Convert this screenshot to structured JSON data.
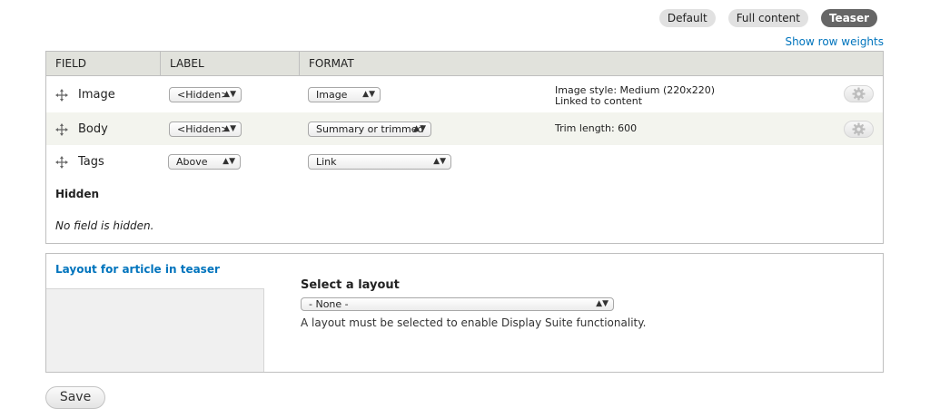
{
  "tabs": [
    {
      "label": "Default",
      "active": false
    },
    {
      "label": "Full content",
      "active": false
    },
    {
      "label": "Teaser",
      "active": true
    }
  ],
  "show_row_weights": "Show row weights",
  "table": {
    "headers": {
      "field": "FIELD",
      "label": "LABEL",
      "format": "FORMAT"
    },
    "rows": [
      {
        "name": "Image",
        "label": "<Hidden>",
        "format": "Image",
        "summary": [
          "Image style: Medium (220x220)",
          "Linked to content"
        ],
        "icons": {
          "drag": "drag-handle-icon",
          "settings": "gear-icon"
        }
      },
      {
        "name": "Body",
        "label": "<Hidden>",
        "format": "Summary or trimmed",
        "summary": [
          "Trim length: 600"
        ],
        "icons": {
          "drag": "drag-handle-icon",
          "settings": "gear-icon"
        }
      },
      {
        "name": "Tags",
        "label": "Above",
        "format": "Link",
        "summary": [],
        "icons": {
          "drag": "drag-handle-icon"
        }
      }
    ],
    "hidden_title": "Hidden",
    "hidden_empty": "No field is hidden."
  },
  "layout": {
    "title": "Layout for article in teaser",
    "select_label": "Select a layout",
    "select_value": "- None -",
    "description": "A layout must be selected to enable Display Suite functionality."
  },
  "save_label": "Save",
  "colors": {
    "link": "#0074bd",
    "active_tab": "#666666",
    "header_bg": "#e1e2dc",
    "alt_row_bg": "#f3f4ee"
  }
}
